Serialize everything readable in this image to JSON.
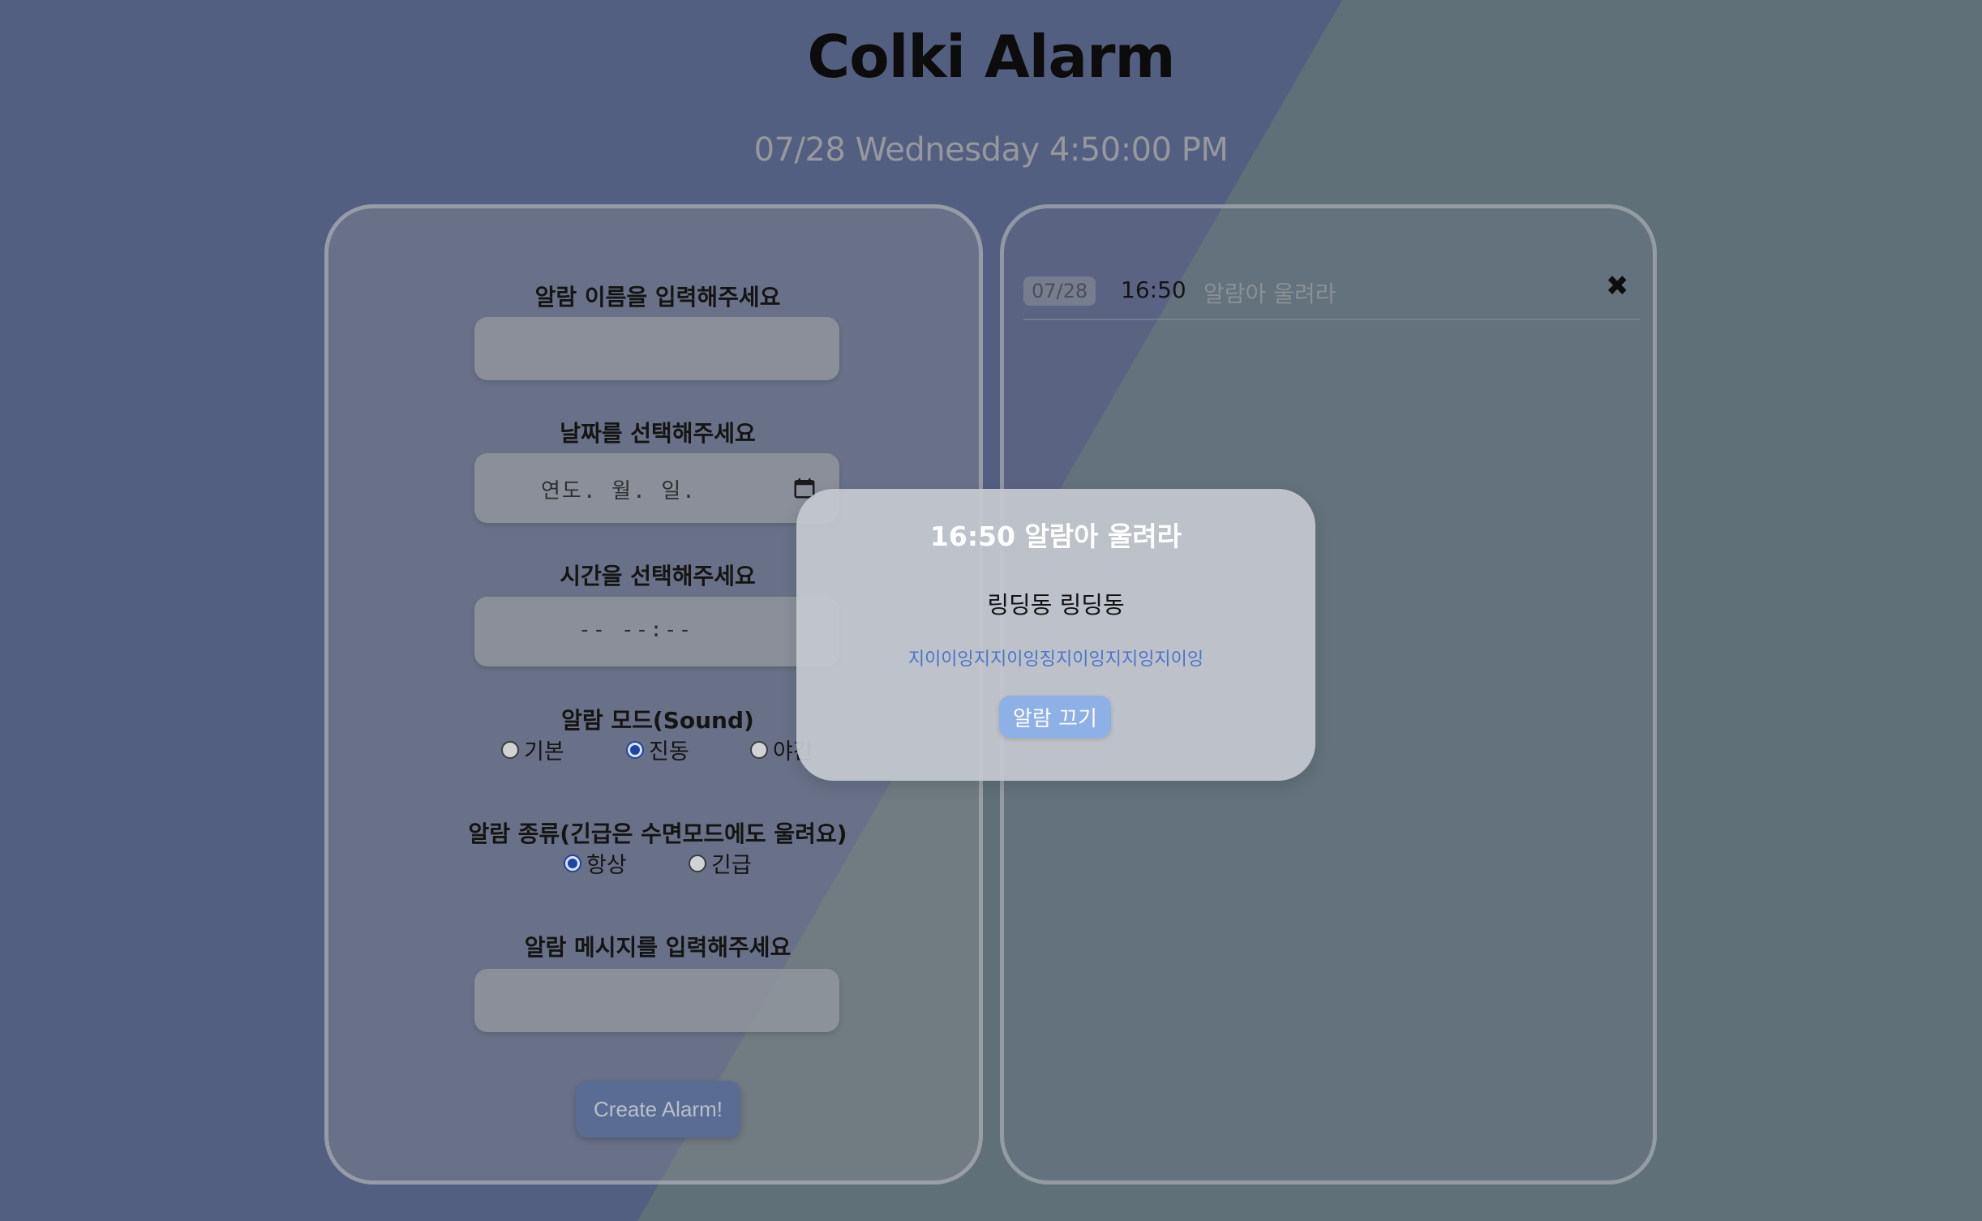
{
  "app": {
    "title": "Colki Alarm",
    "clock": "07/28 Wednesday 4:50:00 PM"
  },
  "form": {
    "name_label": "알람 이름을 입력해주세요",
    "name_value": "",
    "date_label": "날짜를 선택해주세요",
    "date_placeholder": "연도. 월. 일.",
    "time_label": "시간을 선택해주세요",
    "time_placeholder": "-- --:--",
    "mode_label": "알람 모드(Sound)",
    "mode_options": [
      {
        "label": "기본",
        "checked": false
      },
      {
        "label": "진동",
        "checked": true
      },
      {
        "label": "야간",
        "checked": false
      }
    ],
    "type_label": "알람 종류(긴급은 수면모드에도 울려요)",
    "type_options": [
      {
        "label": "항상",
        "checked": true
      },
      {
        "label": "긴급",
        "checked": false
      }
    ],
    "message_label": "알람 메시지를 입력해주세요",
    "message_value": "",
    "create_button": "Create Alarm!"
  },
  "alarm_list": [
    {
      "date": "07/28",
      "time": "16:50",
      "name": "알람아 울려라",
      "delete_icon": "close-icon"
    }
  ],
  "modal": {
    "title": "16:50 알람아 울려라",
    "message": "링딩동 링딩동",
    "sub_message": "지이이잉지지이잉징지이잉지지잉지이잉",
    "button": "알람 끄기"
  },
  "colors": {
    "background_blue": "#535f80",
    "background_gray": "#5f7079",
    "accent_button": "#8db0e6",
    "radio_checked": "#1b45a8"
  }
}
